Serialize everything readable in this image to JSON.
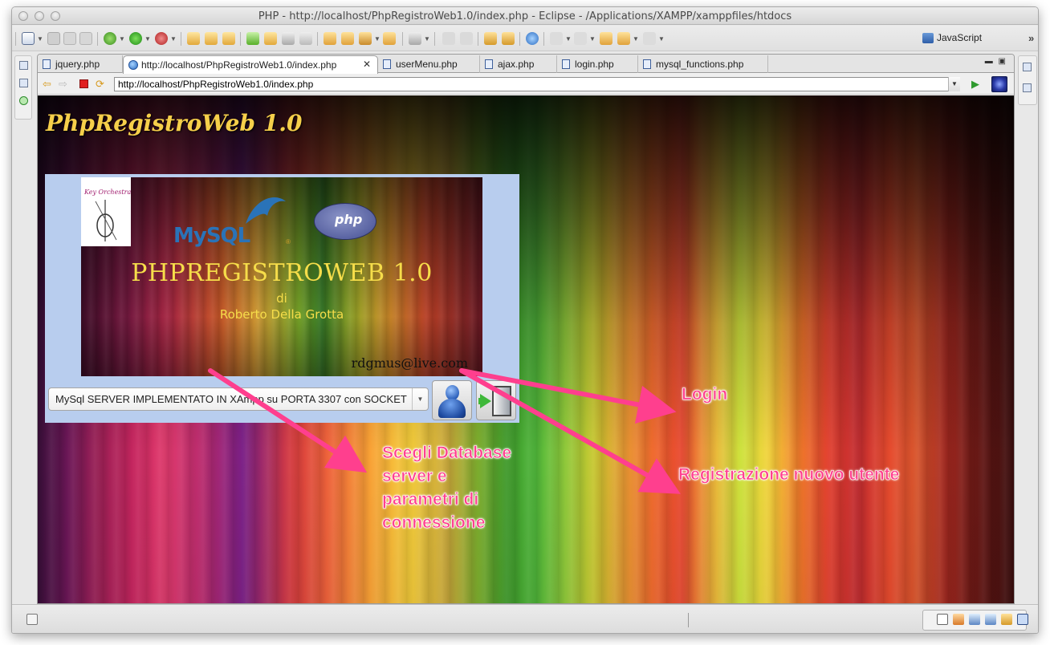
{
  "window": {
    "title": "PHP - http://localhost/PhpRegistroWeb1.0/index.php - Eclipse - /Applications/XAMPP/xamppfiles/htdocs"
  },
  "toolbar": {
    "perspective_label": "JavaScript",
    "overflow_glyph": "»"
  },
  "tabs": [
    {
      "label": "jquery.php",
      "icon": "php-file-icon",
      "active": false
    },
    {
      "label": "http://localhost/PhpRegistroWeb1.0/index.php",
      "icon": "globe-icon",
      "active": true
    },
    {
      "label": "userMenu.php",
      "icon": "php-file-icon",
      "active": false
    },
    {
      "label": "ajax.php",
      "icon": "php-file-icon",
      "active": false
    },
    {
      "label": "login.php",
      "icon": "php-file-icon",
      "active": false
    },
    {
      "label": "mysql_functions.php",
      "icon": "php-file-icon",
      "active": false
    }
  ],
  "browser": {
    "url": "http://localhost/PhpRegistroWeb1.0/index.php"
  },
  "page": {
    "site_title": "PhpRegistroWeb 1.0",
    "banner": {
      "logo_text": "Key Orchestra",
      "mysql_logo_text": "MySQL",
      "php_logo_text": "php",
      "title": "PHPREGISTROWEB 1.0",
      "by": "di",
      "author": "Roberto Della Grotta",
      "email": "rdgmus@live.com"
    },
    "db_select": {
      "selected": "MySql SERVER IMPLEMENTATO IN XAmpp su PORTA 3307 con SOCKET"
    },
    "annotations": {
      "login": "Login",
      "choose_db": [
        "Scegli Database",
        "server e",
        "parametri di",
        "connessione"
      ],
      "register": "Registrazione nuovo utente"
    }
  },
  "colors": {
    "annotation": "#ff3f8e",
    "site_title": "#f6cf4a",
    "panel_bg": "#b8cdee"
  }
}
